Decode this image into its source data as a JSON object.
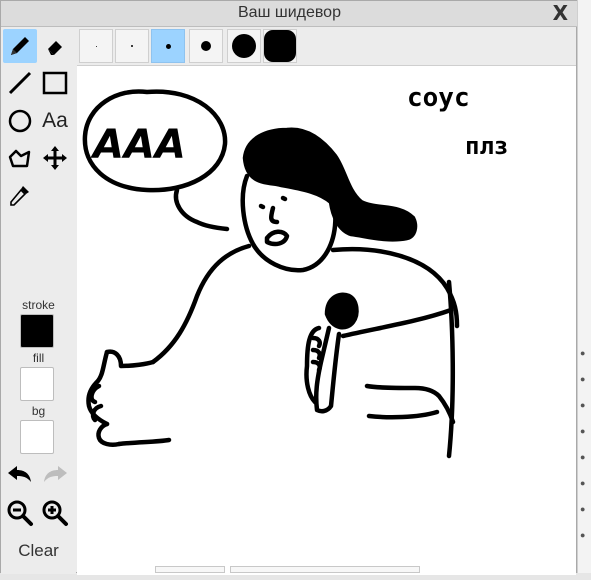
{
  "window": {
    "title": "Ваш шидевор",
    "close_glyph": "X"
  },
  "tools": [
    {
      "name": "pencil",
      "active": true
    },
    {
      "name": "eraser",
      "active": false
    },
    {
      "name": "line",
      "active": false
    },
    {
      "name": "rectangle",
      "active": false
    },
    {
      "name": "ellipse",
      "active": false
    },
    {
      "name": "text",
      "active": false,
      "label": "Aa"
    },
    {
      "name": "polygon",
      "active": false
    },
    {
      "name": "move",
      "active": false
    },
    {
      "name": "eyedropper",
      "active": false
    }
  ],
  "brush_sizes": {
    "options": [
      "1",
      "2",
      "4",
      "10",
      "24",
      "32"
    ],
    "selected": "4"
  },
  "colors": {
    "stroke_label": "stroke",
    "fill_label": "fill",
    "bg_label": "bg",
    "stroke": "#000000",
    "fill": "#ffffff",
    "bg": "#ffffff",
    "accent": "#9cd3ff"
  },
  "history": {
    "undo_enabled": true,
    "redo_enabled": false
  },
  "zoom": {
    "out_icon": "zoom-out-icon",
    "in_icon": "zoom-in-icon"
  },
  "clear_label": "Clear",
  "drawing": {
    "speech_text": "AAA",
    "caption_line1": "соус",
    "caption_line2": "плз"
  }
}
